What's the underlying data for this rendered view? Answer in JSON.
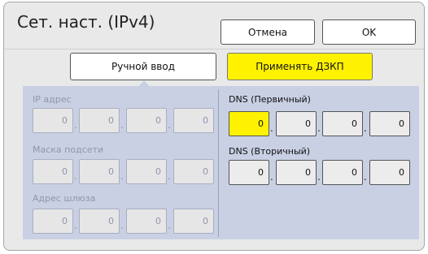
{
  "title": "Сет. наст. (IPv4)",
  "buttons": {
    "cancel": "Отмена",
    "ok": "OK"
  },
  "modes": {
    "manual": "Ручной ввод",
    "dhcp": "Применять ДЗКП"
  },
  "left": {
    "ip_label": "IP адрес",
    "ip": [
      "0",
      "0",
      "0",
      "0"
    ],
    "mask_label": "Маска подсети",
    "mask": [
      "0",
      "0",
      "0",
      "0"
    ],
    "gateway_label": "Адрес шлюза",
    "gateway": [
      "0",
      "0",
      "0",
      "0"
    ]
  },
  "right": {
    "dns1_label": "DNS (Первичный)",
    "dns1": [
      "0",
      "0",
      "0",
      "0"
    ],
    "dns2_label": "DNS (Вторичный)",
    "dns2": [
      "0",
      "0",
      "0",
      "0"
    ]
  },
  "separator": ".",
  "colors": {
    "dhcp_button": "#fff200",
    "active_field": "#fff200",
    "panel": "#c9d0e3"
  }
}
